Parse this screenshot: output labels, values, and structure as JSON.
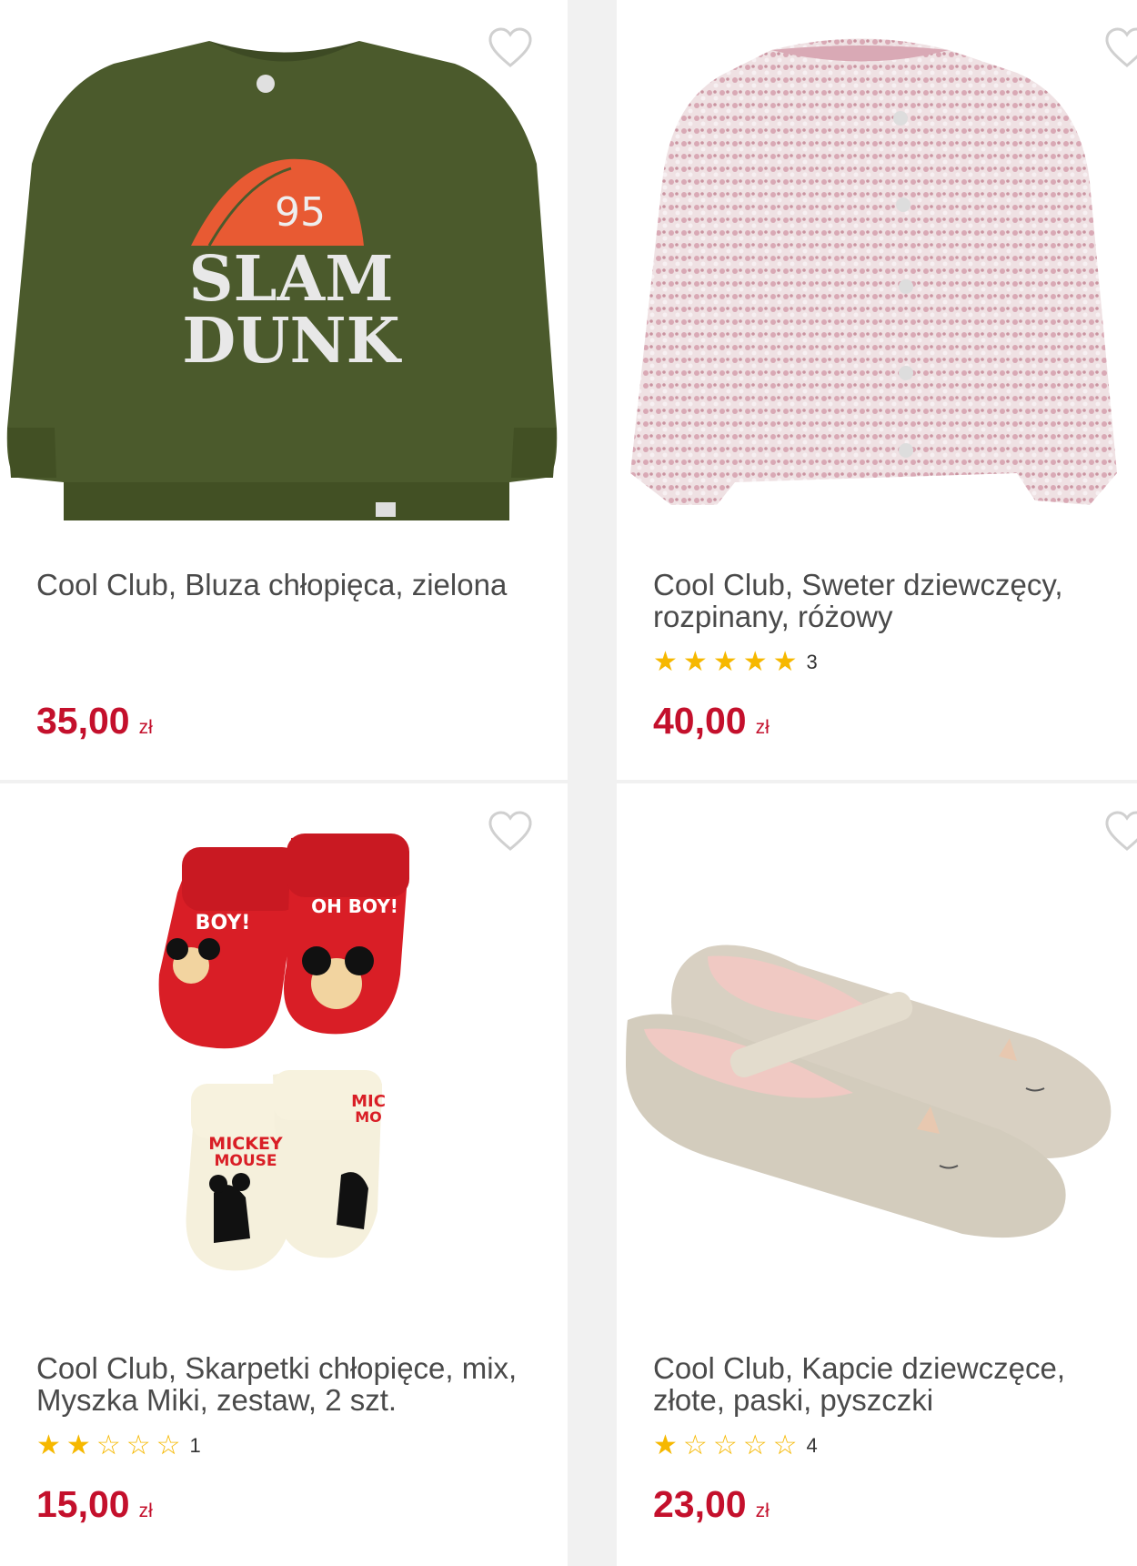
{
  "products": [
    {
      "name": "Cool Club, Bluza chłopięca, zielona",
      "rating_stars": 0,
      "rating_count": "",
      "price": "35,00",
      "currency": "zł",
      "image": "green-sweatshirt",
      "image_text": [
        "95",
        "SLAM",
        "DUNK"
      ]
    },
    {
      "name": "Cool Club, Sweter dziewczęcy, rozpinany, różowy",
      "rating_stars": 5,
      "rating_count": "3",
      "price": "40,00",
      "currency": "zł",
      "image": "pink-cardigan"
    },
    {
      "name": "Cool Club, Skarpetki chłopięce, mix, Myszka Miki, zestaw, 2 szt.",
      "rating_stars": 2,
      "rating_count": "1",
      "price": "15,00",
      "currency": "zł",
      "image": "mickey-socks",
      "image_text": [
        "BOY!",
        "OH BOY!",
        "MICKEY",
        "MOUSE",
        "MIC",
        "MO"
      ]
    },
    {
      "name": "Cool Club, Kapcie dziewczęce, złote, paski, pyszczki",
      "rating_stars": 1,
      "rating_count": "4",
      "price": "23,00",
      "currency": "zł",
      "image": "gold-slippers"
    }
  ],
  "colors": {
    "price": "#c4102c",
    "star": "#f6b800",
    "title": "#4a4a4a",
    "heart_outline": "#d0d0d0"
  },
  "icons": {
    "wishlist": "heart-outline-icon",
    "star_full": "star-filled-icon",
    "star_empty": "star-outline-icon"
  }
}
